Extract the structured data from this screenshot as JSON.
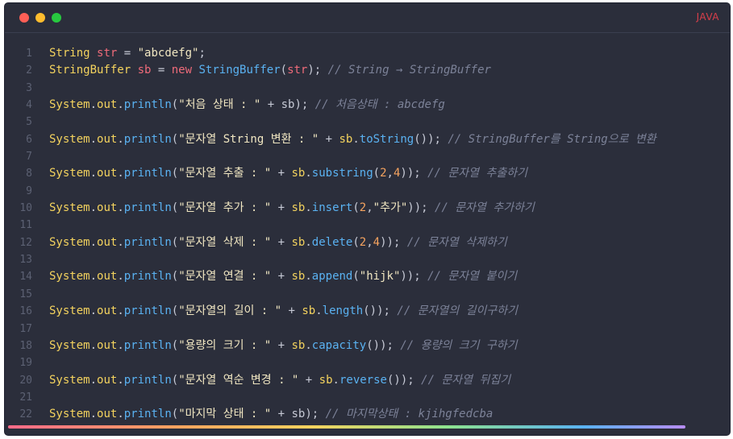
{
  "window": {
    "language": "JAVA"
  },
  "code": {
    "lines": [
      {
        "n": "1",
        "tokens": [
          {
            "t": "String",
            "c": "type"
          },
          {
            "t": " ",
            "c": "plain"
          },
          {
            "t": "str",
            "c": "var"
          },
          {
            "t": " = ",
            "c": "op"
          },
          {
            "t": "\"abcdefg\"",
            "c": "str"
          },
          {
            "t": ";",
            "c": "plain"
          }
        ]
      },
      {
        "n": "2",
        "tokens": [
          {
            "t": "StringBuffer",
            "c": "type"
          },
          {
            "t": " ",
            "c": "plain"
          },
          {
            "t": "sb",
            "c": "var"
          },
          {
            "t": " = ",
            "c": "op"
          },
          {
            "t": "new",
            "c": "kw"
          },
          {
            "t": " ",
            "c": "plain"
          },
          {
            "t": "StringBuffer",
            "c": "cls"
          },
          {
            "t": "(",
            "c": "plain"
          },
          {
            "t": "str",
            "c": "var"
          },
          {
            "t": "); ",
            "c": "plain"
          },
          {
            "t": "// String → StringBuffer",
            "c": "comment"
          }
        ]
      },
      {
        "n": "3",
        "tokens": []
      },
      {
        "n": "4",
        "tokens": [
          {
            "t": "System",
            "c": "sys"
          },
          {
            "t": ".",
            "c": "plain"
          },
          {
            "t": "out",
            "c": "out"
          },
          {
            "t": ".",
            "c": "plain"
          },
          {
            "t": "println",
            "c": "method"
          },
          {
            "t": "(",
            "c": "plain"
          },
          {
            "t": "\"처음 상태 : \"",
            "c": "str"
          },
          {
            "t": " + sb); ",
            "c": "plain"
          },
          {
            "t": "// 처음상태 : abcdefg",
            "c": "comment"
          }
        ]
      },
      {
        "n": "5",
        "tokens": []
      },
      {
        "n": "6",
        "tokens": [
          {
            "t": "System",
            "c": "sys"
          },
          {
            "t": ".",
            "c": "plain"
          },
          {
            "t": "out",
            "c": "out"
          },
          {
            "t": ".",
            "c": "plain"
          },
          {
            "t": "println",
            "c": "method"
          },
          {
            "t": "(",
            "c": "plain"
          },
          {
            "t": "\"문자열 String 변환 : \"",
            "c": "str"
          },
          {
            "t": " + ",
            "c": "plain"
          },
          {
            "t": "sb",
            "c": "sys"
          },
          {
            "t": ".",
            "c": "plain"
          },
          {
            "t": "toString",
            "c": "method"
          },
          {
            "t": "()); ",
            "c": "plain"
          },
          {
            "t": "// StringBuffer를 String으로 변환",
            "c": "comment"
          }
        ]
      },
      {
        "n": "7",
        "tokens": []
      },
      {
        "n": "8",
        "tokens": [
          {
            "t": "System",
            "c": "sys"
          },
          {
            "t": ".",
            "c": "plain"
          },
          {
            "t": "out",
            "c": "out"
          },
          {
            "t": ".",
            "c": "plain"
          },
          {
            "t": "println",
            "c": "method"
          },
          {
            "t": "(",
            "c": "plain"
          },
          {
            "t": "\"문자열 추출 : \"",
            "c": "str"
          },
          {
            "t": " + ",
            "c": "plain"
          },
          {
            "t": "sb",
            "c": "sys"
          },
          {
            "t": ".",
            "c": "plain"
          },
          {
            "t": "substring",
            "c": "method"
          },
          {
            "t": "(",
            "c": "plain"
          },
          {
            "t": "2",
            "c": "num"
          },
          {
            "t": ",",
            "c": "plain"
          },
          {
            "t": "4",
            "c": "num"
          },
          {
            "t": ")); ",
            "c": "plain"
          },
          {
            "t": "// 문자열 추출하기",
            "c": "comment"
          }
        ]
      },
      {
        "n": "9",
        "tokens": []
      },
      {
        "n": "10",
        "tokens": [
          {
            "t": "System",
            "c": "sys"
          },
          {
            "t": ".",
            "c": "plain"
          },
          {
            "t": "out",
            "c": "out"
          },
          {
            "t": ".",
            "c": "plain"
          },
          {
            "t": "println",
            "c": "method"
          },
          {
            "t": "(",
            "c": "plain"
          },
          {
            "t": "\"문자열 추가 : \"",
            "c": "str"
          },
          {
            "t": " + ",
            "c": "plain"
          },
          {
            "t": "sb",
            "c": "sys"
          },
          {
            "t": ".",
            "c": "plain"
          },
          {
            "t": "insert",
            "c": "method"
          },
          {
            "t": "(",
            "c": "plain"
          },
          {
            "t": "2",
            "c": "num"
          },
          {
            "t": ",",
            "c": "plain"
          },
          {
            "t": "\"추가\"",
            "c": "str"
          },
          {
            "t": ")); ",
            "c": "plain"
          },
          {
            "t": "// 문자열 추가하기",
            "c": "comment"
          }
        ]
      },
      {
        "n": "11",
        "tokens": []
      },
      {
        "n": "12",
        "tokens": [
          {
            "t": "System",
            "c": "sys"
          },
          {
            "t": ".",
            "c": "plain"
          },
          {
            "t": "out",
            "c": "out"
          },
          {
            "t": ".",
            "c": "plain"
          },
          {
            "t": "println",
            "c": "method"
          },
          {
            "t": "(",
            "c": "plain"
          },
          {
            "t": "\"문자열 삭제 : \"",
            "c": "str"
          },
          {
            "t": " + ",
            "c": "plain"
          },
          {
            "t": "sb",
            "c": "sys"
          },
          {
            "t": ".",
            "c": "plain"
          },
          {
            "t": "delete",
            "c": "method"
          },
          {
            "t": "(",
            "c": "plain"
          },
          {
            "t": "2",
            "c": "num"
          },
          {
            "t": ",",
            "c": "plain"
          },
          {
            "t": "4",
            "c": "num"
          },
          {
            "t": ")); ",
            "c": "plain"
          },
          {
            "t": "// 문자열 삭제하기",
            "c": "comment"
          }
        ]
      },
      {
        "n": "13",
        "tokens": []
      },
      {
        "n": "14",
        "tokens": [
          {
            "t": "System",
            "c": "sys"
          },
          {
            "t": ".",
            "c": "plain"
          },
          {
            "t": "out",
            "c": "out"
          },
          {
            "t": ".",
            "c": "plain"
          },
          {
            "t": "println",
            "c": "method"
          },
          {
            "t": "(",
            "c": "plain"
          },
          {
            "t": "\"문자열 연결 : \"",
            "c": "str"
          },
          {
            "t": " + ",
            "c": "plain"
          },
          {
            "t": "sb",
            "c": "sys"
          },
          {
            "t": ".",
            "c": "plain"
          },
          {
            "t": "append",
            "c": "method"
          },
          {
            "t": "(",
            "c": "plain"
          },
          {
            "t": "\"hijk\"",
            "c": "str"
          },
          {
            "t": ")); ",
            "c": "plain"
          },
          {
            "t": "// 문자열 붙이기",
            "c": "comment"
          }
        ]
      },
      {
        "n": "15",
        "tokens": []
      },
      {
        "n": "16",
        "tokens": [
          {
            "t": "System",
            "c": "sys"
          },
          {
            "t": ".",
            "c": "plain"
          },
          {
            "t": "out",
            "c": "out"
          },
          {
            "t": ".",
            "c": "plain"
          },
          {
            "t": "println",
            "c": "method"
          },
          {
            "t": "(",
            "c": "plain"
          },
          {
            "t": "\"문자열의 길이 : \"",
            "c": "str"
          },
          {
            "t": " + ",
            "c": "plain"
          },
          {
            "t": "sb",
            "c": "sys"
          },
          {
            "t": ".",
            "c": "plain"
          },
          {
            "t": "length",
            "c": "method"
          },
          {
            "t": "()); ",
            "c": "plain"
          },
          {
            "t": "// 문자열의 길이구하기",
            "c": "comment"
          }
        ]
      },
      {
        "n": "17",
        "tokens": []
      },
      {
        "n": "18",
        "tokens": [
          {
            "t": "System",
            "c": "sys"
          },
          {
            "t": ".",
            "c": "plain"
          },
          {
            "t": "out",
            "c": "out"
          },
          {
            "t": ".",
            "c": "plain"
          },
          {
            "t": "println",
            "c": "method"
          },
          {
            "t": "(",
            "c": "plain"
          },
          {
            "t": "\"용량의 크기 : \"",
            "c": "str"
          },
          {
            "t": " + ",
            "c": "plain"
          },
          {
            "t": "sb",
            "c": "sys"
          },
          {
            "t": ".",
            "c": "plain"
          },
          {
            "t": "capacity",
            "c": "method"
          },
          {
            "t": "()); ",
            "c": "plain"
          },
          {
            "t": "// 용량의 크기 구하기",
            "c": "comment"
          }
        ]
      },
      {
        "n": "19",
        "tokens": []
      },
      {
        "n": "20",
        "tokens": [
          {
            "t": "System",
            "c": "sys"
          },
          {
            "t": ".",
            "c": "plain"
          },
          {
            "t": "out",
            "c": "out"
          },
          {
            "t": ".",
            "c": "plain"
          },
          {
            "t": "println",
            "c": "method"
          },
          {
            "t": "(",
            "c": "plain"
          },
          {
            "t": "\"문자열 역순 변경 : \"",
            "c": "str"
          },
          {
            "t": " + ",
            "c": "plain"
          },
          {
            "t": "sb",
            "c": "sys"
          },
          {
            "t": ".",
            "c": "plain"
          },
          {
            "t": "reverse",
            "c": "method"
          },
          {
            "t": "()); ",
            "c": "plain"
          },
          {
            "t": "// 문자열 뒤집기",
            "c": "comment"
          }
        ]
      },
      {
        "n": "21",
        "tokens": []
      },
      {
        "n": "22",
        "tokens": [
          {
            "t": "System",
            "c": "sys"
          },
          {
            "t": ".",
            "c": "plain"
          },
          {
            "t": "out",
            "c": "out"
          },
          {
            "t": ".",
            "c": "plain"
          },
          {
            "t": "println",
            "c": "method"
          },
          {
            "t": "(",
            "c": "plain"
          },
          {
            "t": "\"마지막 상태 : \"",
            "c": "str"
          },
          {
            "t": " + sb); ",
            "c": "plain"
          },
          {
            "t": "// 마지막상태 : kjihgfedcba",
            "c": "comment"
          }
        ]
      }
    ]
  }
}
